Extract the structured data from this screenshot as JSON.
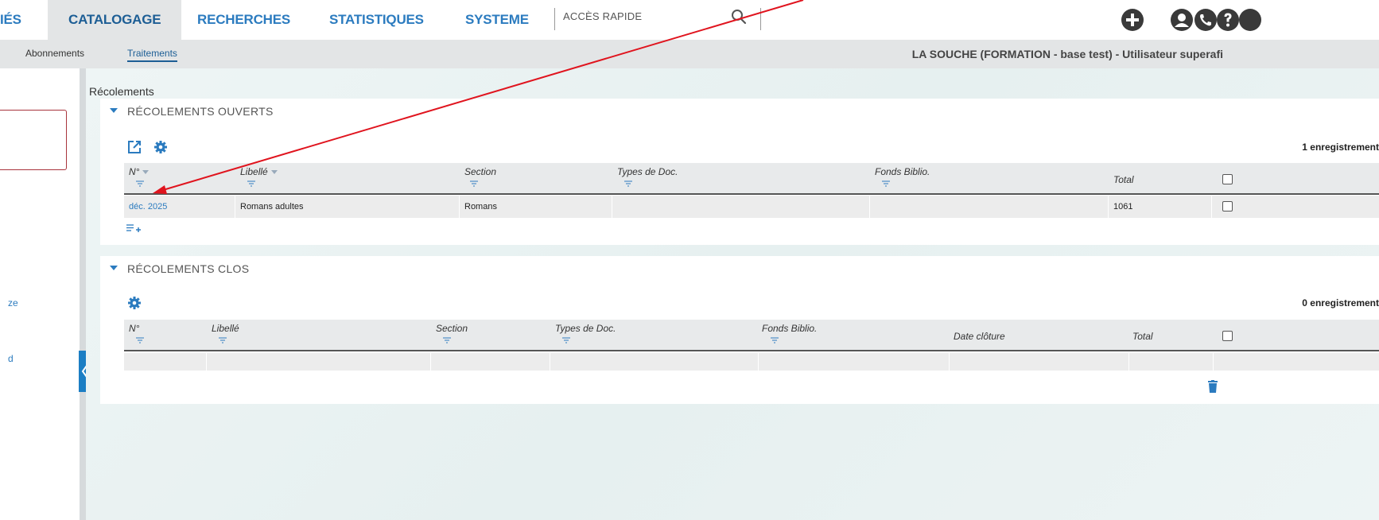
{
  "nav": {
    "items": [
      {
        "label": "IÉS"
      },
      {
        "label": "CATALOGAGE"
      },
      {
        "label": "RECHERCHES"
      },
      {
        "label": "STATISTIQUES"
      },
      {
        "label": "SYSTEME"
      }
    ],
    "quick_access": "ACCÈS RAPIDE"
  },
  "subnav": {
    "items": [
      {
        "label": "Abonnements"
      },
      {
        "label": "Traitements"
      }
    ],
    "base_info": "LA SOUCHE (FORMATION - base test) - Utilisateur superafi"
  },
  "left": {
    "links": [
      {
        "label": "ze"
      },
      {
        "label": "d"
      }
    ]
  },
  "page_title": "Récolements",
  "open_panel": {
    "title": "RÉCOLEMENTS OUVERTS",
    "count": "1 enregistrement",
    "columns": [
      "N°",
      "Libellé",
      "Section",
      "Types de Doc.",
      "Fonds Biblio.",
      "Total"
    ],
    "rows": [
      {
        "num": "déc. 2025",
        "libelle": "Romans adultes",
        "section": "Romans",
        "types": "",
        "fonds": "",
        "total": "1061"
      }
    ]
  },
  "closed_panel": {
    "title": "RÉCOLEMENTS CLOS",
    "count": "0 enregistrement",
    "columns": [
      "N°",
      "Libellé",
      "Section",
      "Types de Doc.",
      "Fonds Biblio.",
      "Date clôture",
      "Total"
    ]
  },
  "colors": {
    "accent": "#2b7bbf",
    "annotation_arrow": "#e0141e"
  }
}
